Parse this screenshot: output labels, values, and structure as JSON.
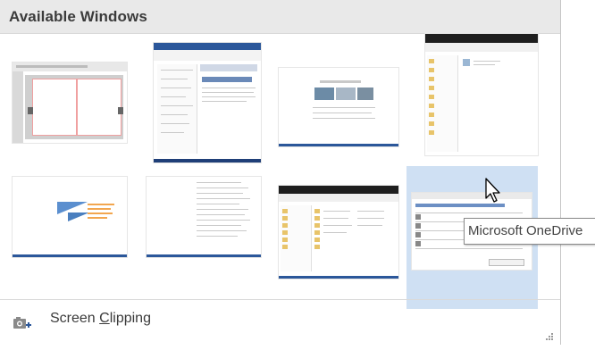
{
  "header": {
    "title": "Available Windows"
  },
  "windows": [
    {
      "id": "w1",
      "kind": "publisher-doc"
    },
    {
      "id": "w2",
      "kind": "word-doc"
    },
    {
      "id": "w3",
      "kind": "blank-doc"
    },
    {
      "id": "w4",
      "kind": "file-explorer"
    },
    {
      "id": "w5",
      "kind": "slide-orange"
    },
    {
      "id": "w6",
      "kind": "text-doc"
    },
    {
      "id": "w7",
      "kind": "file-explorer-dark"
    },
    {
      "id": "w8",
      "kind": "onedrive-dialog",
      "hovered": true
    }
  ],
  "tooltip": {
    "text": "Microsoft OneDrive"
  },
  "footer": {
    "clip_prefix": "Screen ",
    "clip_underlined": "C",
    "clip_rest": "lipping"
  },
  "colors": {
    "accent": "#2b579a",
    "hover": "#cfe0f3",
    "header": "#e9e9e9"
  },
  "icons": {
    "clip": "camera-plus-icon",
    "grip": "resize-grip-icon",
    "cursor": "mouse-pointer-icon"
  }
}
